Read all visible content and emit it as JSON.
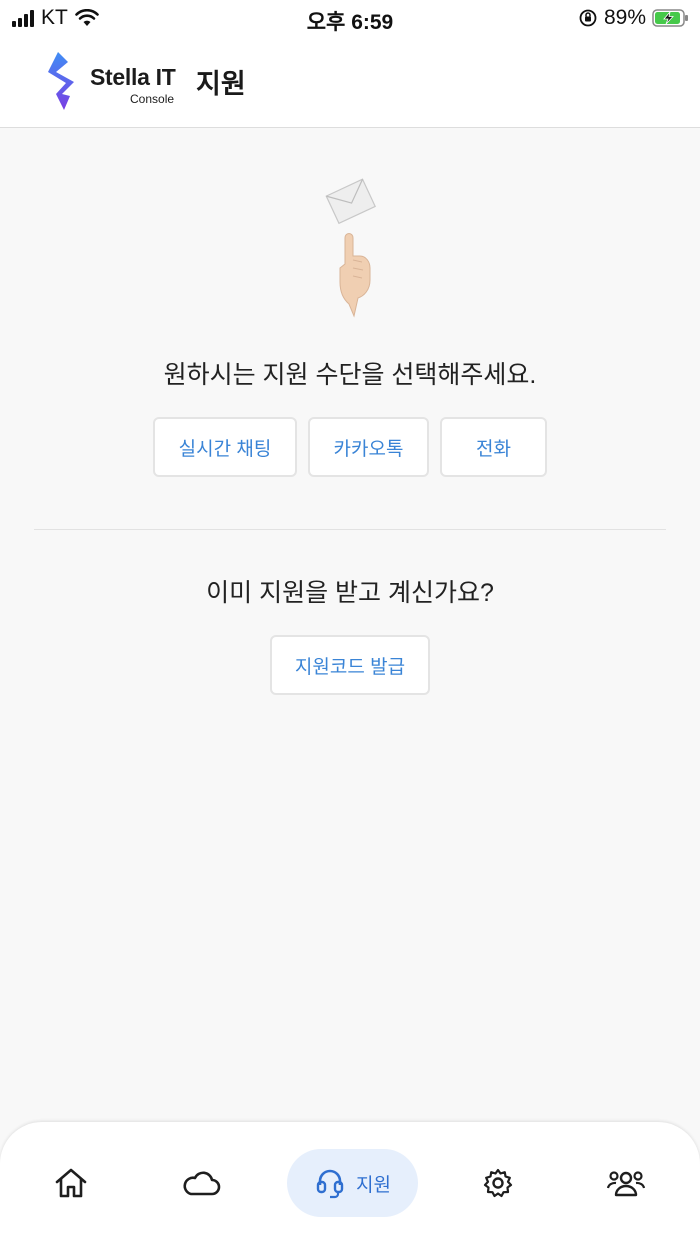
{
  "status_bar": {
    "carrier": "KT",
    "time": "오후 6:59",
    "battery": "89%"
  },
  "header": {
    "logo_text": "Stella IT",
    "logo_subtext": "Console",
    "title": "지원"
  },
  "main": {
    "prompt": "원하시는 지원 수단을 선택해주세요.",
    "options": [
      {
        "label": "실시간 채팅"
      },
      {
        "label": "카카오톡"
      },
      {
        "label": "전화"
      }
    ],
    "secondary_prompt": "이미 지원을 받고 계신가요?",
    "support_code_button": "지원코드 발급"
  },
  "bottom_nav": {
    "items": [
      {
        "icon": "home-icon"
      },
      {
        "icon": "cloud-icon"
      },
      {
        "icon": "headset-icon",
        "label": "지원",
        "active": true
      },
      {
        "icon": "gear-icon"
      },
      {
        "icon": "users-icon"
      }
    ]
  },
  "colors": {
    "accent": "#3a84d6",
    "active_nav_bg": "#e6effc",
    "background": "#f8f8f8"
  }
}
